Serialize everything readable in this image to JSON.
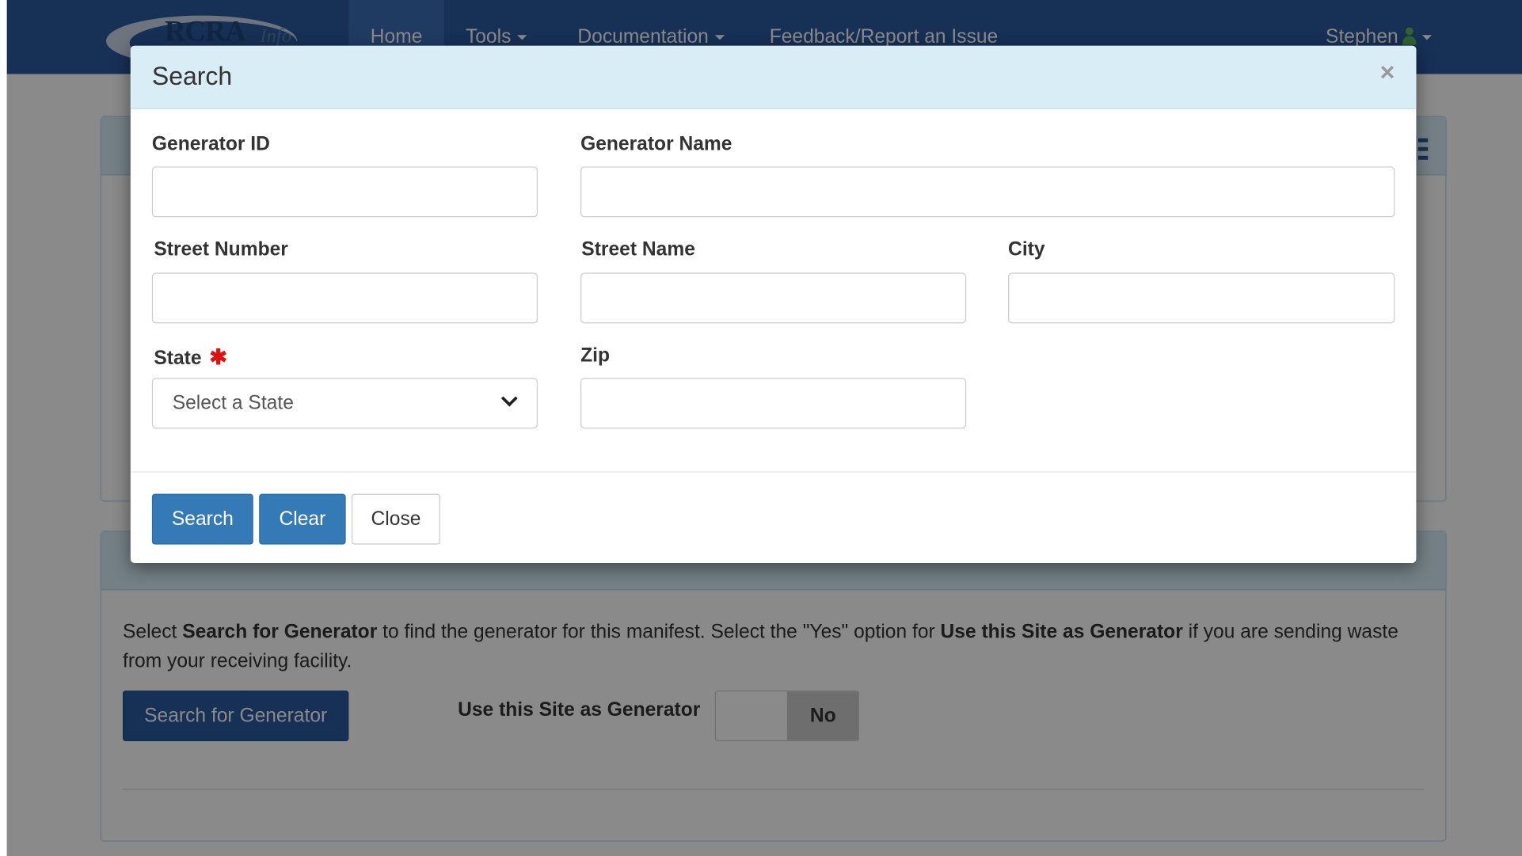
{
  "app": {
    "logo_text": "RCRA",
    "logo_script": "Info"
  },
  "nav": {
    "home": "Home",
    "tools": "Tools",
    "documentation": "Documentation",
    "feedback": "Feedback/Report an Issue",
    "user": "Stephen"
  },
  "generator_panel": {
    "desc_prefix": "Select ",
    "desc_bold1": "Search for Generator",
    "desc_mid": " to find the generator for this manifest. Select the \"Yes\" option for ",
    "desc_bold2": "Use this Site as Generator",
    "desc_suffix": " if you are sending waste from your receiving facility.",
    "search_button": "Search for Generator",
    "use_site_label": "Use this Site as Generator",
    "toggle_value": "No"
  },
  "modal": {
    "title": "Search",
    "close_symbol": "×",
    "fields": {
      "generator_id": {
        "label": "Generator ID",
        "value": "",
        "placeholder": ""
      },
      "generator_name": {
        "label": "Generator Name",
        "value": "",
        "placeholder": ""
      },
      "street_number": {
        "label": "Street Number",
        "value": "",
        "placeholder": ""
      },
      "street_name": {
        "label": "Street Name",
        "value": "",
        "placeholder": ""
      },
      "city": {
        "label": "City",
        "value": "",
        "placeholder": ""
      },
      "state": {
        "label": "State",
        "required_marker": "✱",
        "selected": "Select a State"
      },
      "zip": {
        "label": "Zip",
        "value": "",
        "placeholder": ""
      }
    },
    "buttons": {
      "search": "Search",
      "clear": "Clear",
      "close": "Close"
    }
  },
  "colors": {
    "navbar": "#2c5aa0",
    "primary_button": "#337ab7",
    "modal_header": "#d9edf7",
    "required": "#e01010",
    "user_icon": "#5cb85c"
  }
}
